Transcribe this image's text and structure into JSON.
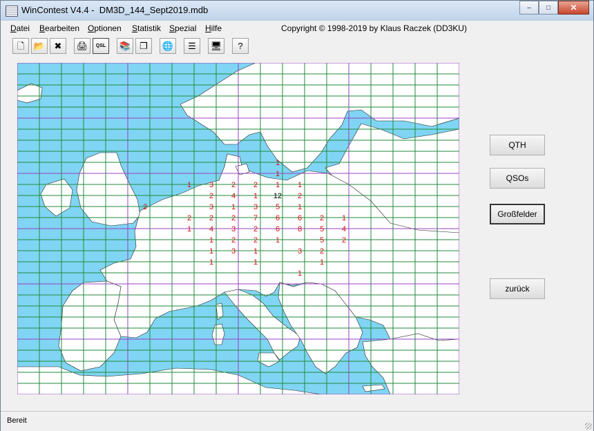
{
  "window": {
    "title": "WinContest V4.4 -  DM3D_144_Sept2019.mdb",
    "minimize_glyph": "–",
    "maximize_glyph": "□",
    "close_glyph": "✕"
  },
  "menu": {
    "items": [
      "Datei",
      "Bearbeiten",
      "Optionen",
      "Statistik",
      "Spezial",
      "Hilfe"
    ],
    "copyright": "Copyright © 1998-2019 by Klaus Raczek (DD3KU)"
  },
  "toolbar": {
    "buttons": [
      {
        "name": "new-file-icon",
        "glyph": "🗋"
      },
      {
        "name": "open-folder-icon",
        "glyph": "📂"
      },
      {
        "name": "delete-x-icon",
        "glyph": "✖"
      },
      {
        "name": "printer-icon",
        "glyph": "🖨"
      },
      {
        "name": "qsl-icon",
        "glyph": "QSL"
      },
      {
        "name": "books-icon",
        "glyph": "📚"
      },
      {
        "name": "copy-icon",
        "glyph": "❐"
      },
      {
        "name": "globe-icon",
        "glyph": "🌐"
      },
      {
        "name": "list-grid-icon",
        "glyph": "☰"
      },
      {
        "name": "network-computers-icon",
        "glyph": "🖥"
      },
      {
        "name": "help-clock-icon",
        "glyph": "?"
      }
    ]
  },
  "map": {
    "land_color": "#ffffff",
    "sea_color": "#7fd5f3",
    "grid_color": "#1f8a3a",
    "highlight_grid_color": "#9a40c0",
    "count_color": "#d01010",
    "highlight_count_color": "#000000",
    "counts": [
      {
        "col": 12,
        "row": 9,
        "value": "1"
      },
      {
        "col": 12,
        "row": 10,
        "value": "1"
      },
      {
        "col": 8,
        "row": 11,
        "value": "1"
      },
      {
        "col": 9,
        "row": 11,
        "value": "3"
      },
      {
        "col": 10,
        "row": 11,
        "value": "2"
      },
      {
        "col": 11,
        "row": 11,
        "value": "2"
      },
      {
        "col": 12,
        "row": 11,
        "value": "1"
      },
      {
        "col": 13,
        "row": 11,
        "value": "1"
      },
      {
        "col": 9,
        "row": 12,
        "value": "2"
      },
      {
        "col": 10,
        "row": 12,
        "value": "4"
      },
      {
        "col": 11,
        "row": 12,
        "value": "1"
      },
      {
        "col": 12,
        "row": 12,
        "value": "12",
        "highlight": true
      },
      {
        "col": 13,
        "row": 12,
        "value": "2"
      },
      {
        "col": 6,
        "row": 13,
        "value": "2"
      },
      {
        "col": 9,
        "row": 13,
        "value": "3"
      },
      {
        "col": 10,
        "row": 13,
        "value": "1"
      },
      {
        "col": 11,
        "row": 13,
        "value": "3"
      },
      {
        "col": 12,
        "row": 13,
        "value": "5"
      },
      {
        "col": 13,
        "row": 13,
        "value": "1"
      },
      {
        "col": 8,
        "row": 14,
        "value": "2"
      },
      {
        "col": 9,
        "row": 14,
        "value": "2"
      },
      {
        "col": 10,
        "row": 14,
        "value": "2"
      },
      {
        "col": 11,
        "row": 14,
        "value": "7"
      },
      {
        "col": 12,
        "row": 14,
        "value": "6"
      },
      {
        "col": 13,
        "row": 14,
        "value": "6"
      },
      {
        "col": 14,
        "row": 14,
        "value": "2"
      },
      {
        "col": 15,
        "row": 14,
        "value": "1"
      },
      {
        "col": 8,
        "row": 15,
        "value": "1"
      },
      {
        "col": 9,
        "row": 15,
        "value": "4"
      },
      {
        "col": 10,
        "row": 15,
        "value": "3"
      },
      {
        "col": 11,
        "row": 15,
        "value": "2"
      },
      {
        "col": 12,
        "row": 15,
        "value": "6"
      },
      {
        "col": 13,
        "row": 15,
        "value": "8"
      },
      {
        "col": 14,
        "row": 15,
        "value": "5"
      },
      {
        "col": 15,
        "row": 15,
        "value": "4"
      },
      {
        "col": 9,
        "row": 16,
        "value": "1"
      },
      {
        "col": 10,
        "row": 16,
        "value": "2"
      },
      {
        "col": 11,
        "row": 16,
        "value": "2"
      },
      {
        "col": 12,
        "row": 16,
        "value": "1"
      },
      {
        "col": 14,
        "row": 16,
        "value": "5"
      },
      {
        "col": 15,
        "row": 16,
        "value": "2"
      },
      {
        "col": 9,
        "row": 17,
        "value": "1"
      },
      {
        "col": 10,
        "row": 17,
        "value": "3"
      },
      {
        "col": 11,
        "row": 17,
        "value": "1"
      },
      {
        "col": 13,
        "row": 17,
        "value": "3"
      },
      {
        "col": 14,
        "row": 17,
        "value": "2"
      },
      {
        "col": 9,
        "row": 18,
        "value": "1"
      },
      {
        "col": 11,
        "row": 18,
        "value": "1"
      },
      {
        "col": 14,
        "row": 18,
        "value": "1"
      },
      {
        "col": 13,
        "row": 19,
        "value": "1"
      }
    ]
  },
  "buttons": {
    "qth": "QTH",
    "qsos": "QSOs",
    "grossfelder": "Großfelder",
    "zurueck": "zurück"
  },
  "status": {
    "text": "Bereit"
  }
}
